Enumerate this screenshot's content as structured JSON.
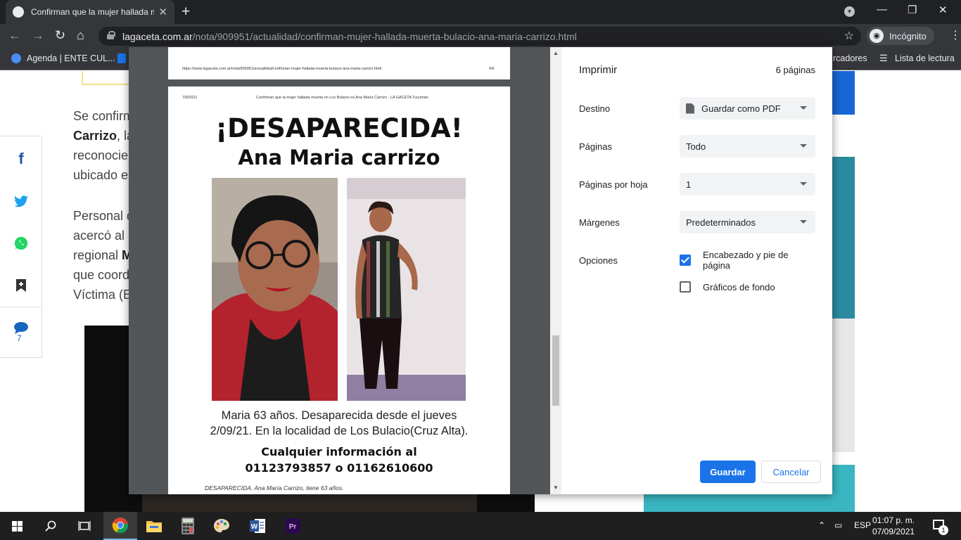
{
  "browser": {
    "tab_title": "Confirman que la mujer hallada muerta en Los Bulacio",
    "url_host": "lagaceta.com.ar",
    "url_path": "/nota/909951/actualidad/confirman-mujer-hallada-muerta-bulacio-ana-maria-carrizo.html",
    "incognito_label": "Incógnito",
    "bookmarks": [
      "Agenda | ENTE CUL...",
      "rcadores",
      "Lista de lectura"
    ]
  },
  "article": {
    "lines": [
      {
        "bold": "",
        "text": "Se confirm"
      },
      {
        "bold": "Carrizo",
        "text": ", la"
      },
      {
        "bold": "",
        "text": "reconocie"
      },
      {
        "bold": "",
        "text": "ubicado e"
      },
      {
        "bold": "",
        "text": "Personal d"
      },
      {
        "bold": "",
        "text": "acercó al"
      },
      {
        "bold": "M",
        "text": "regional "
      },
      {
        "bold": "",
        "text": "que coord"
      },
      {
        "bold": "",
        "text": "Víctima (E"
      }
    ],
    "comment_count": "7",
    "share_colors": {
      "facebook": "#1e5a9e",
      "twitter": "#1da1f2",
      "whatsapp": "#25d366",
      "bookmark": "#333333",
      "comment": "#1565c0"
    }
  },
  "print_preview": {
    "page_a_url": "https://www.lagaceta.com.ar/nota/909951/actualidad/confirman-mujer-hallada-muerta-bulacio-ana-maria-carrizo.html",
    "page_a_number": "4/6",
    "page_b_date": "7/9/2021",
    "page_b_header": "Confirman que la mujer hallada muerta en Los Bulacio es Ana María Carrizo - LA GACETA Tucumán",
    "flyer_title": "¡DESAPARECIDA!",
    "flyer_name": "Ana Maria carrizo",
    "flyer_caption_1": "Maria 63 años. Desaparecida desde el  jueves",
    "flyer_caption_2": "2/09/21. En la localidad de Los Bulacio(Cruz Alta).",
    "flyer_contact_1": "Cualquier información  al",
    "flyer_contact_2": "01123793857 o 01162610600",
    "photo_footer": "DESAPARECIDA. Ana María Carrizo, tiene 63 años."
  },
  "print_settings": {
    "title": "Imprimir",
    "page_count": "6 páginas",
    "destination_label": "Destino",
    "destination_value": "Guardar como PDF",
    "pages_label": "Páginas",
    "pages_value": "Todo",
    "per_sheet_label": "Páginas por hoja",
    "per_sheet_value": "1",
    "margins_label": "Márgenes",
    "margins_value": "Predeterminados",
    "options_label": "Opciones",
    "header_footer_label": "Encabezado y pie de página",
    "header_footer_checked": true,
    "background_label": "Gráficos de fondo",
    "background_checked": false,
    "save_button": "Guardar",
    "cancel_button": "Cancelar"
  },
  "taskbar": {
    "language": "ESP",
    "time": "01:07 p. m.",
    "date": "07/09/2021",
    "notifications": "1"
  }
}
